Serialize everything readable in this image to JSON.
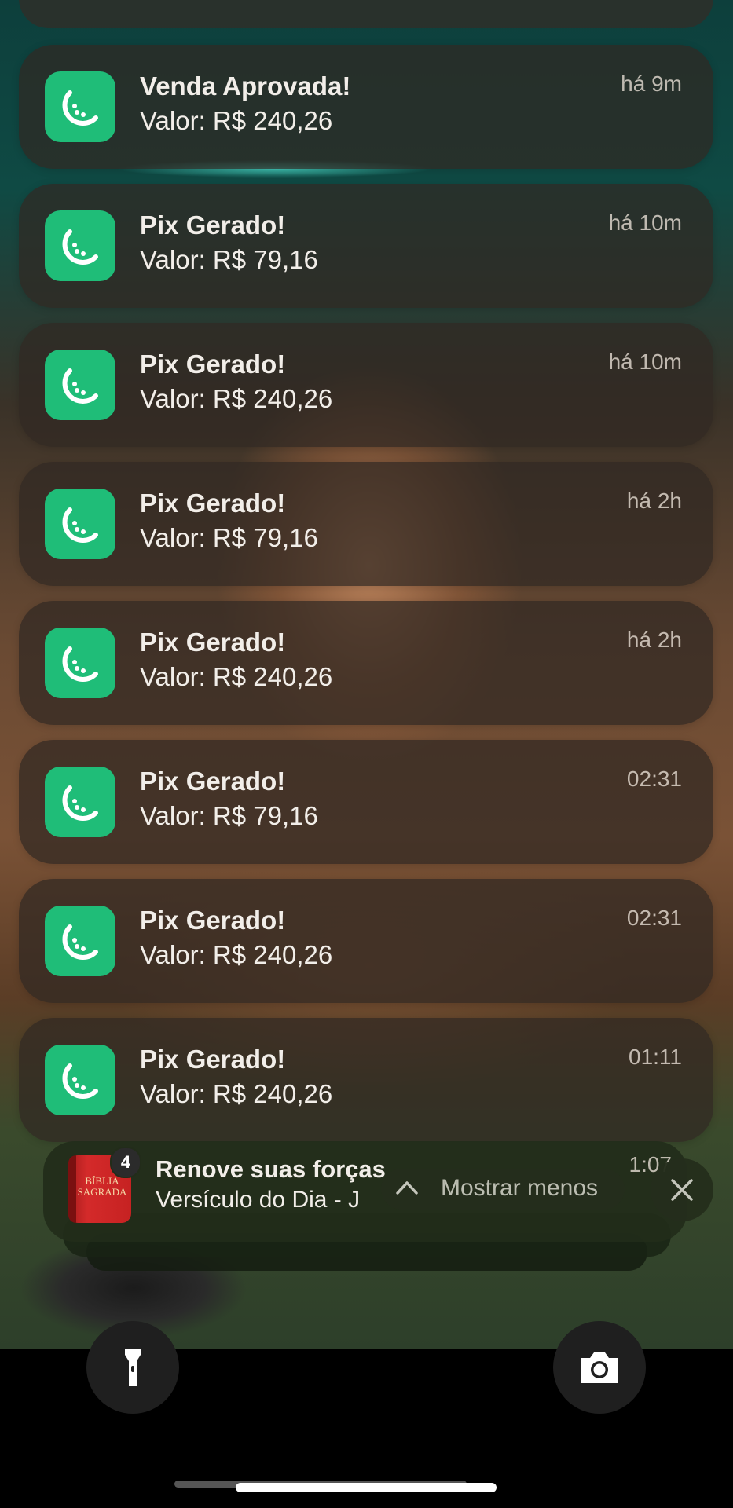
{
  "notifications": [
    {
      "title": "Venda Aprovada!",
      "body": "Valor: R$ 240,26",
      "time": "há 9m"
    },
    {
      "title": "Pix Gerado!",
      "body": "Valor: R$ 79,16",
      "time": "há 10m"
    },
    {
      "title": "Pix Gerado!",
      "body": "Valor: R$ 240,26",
      "time": "há 10m"
    },
    {
      "title": "Pix Gerado!",
      "body": "Valor: R$ 79,16",
      "time": "há 2h"
    },
    {
      "title": "Pix Gerado!",
      "body": "Valor: R$ 240,26",
      "time": "há 2h"
    },
    {
      "title": "Pix Gerado!",
      "body": "Valor: R$ 79,16",
      "time": "02:31"
    },
    {
      "title": "Pix Gerado!",
      "body": "Valor: R$ 240,26",
      "time": "02:31"
    },
    {
      "title": "Pix Gerado!",
      "body": "Valor: R$ 240,26",
      "time": "01:11"
    }
  ],
  "stacked": {
    "title": "Renove suas forças",
    "body": "Versículo do Dia - J",
    "time": "1:07",
    "badge": "4",
    "app_icon_text": "BÍBLIA SAGRADA",
    "show_less_label": "Mostrar menos"
  },
  "colors": {
    "app_icon": "#1fbd78",
    "notification_bg": "rgba(48,40,34,0.72)"
  },
  "icons": {
    "app": "melon-slice-icon",
    "flashlight": "flashlight-icon",
    "camera": "camera-icon",
    "close": "close-icon",
    "collapse": "chevron-up-icon"
  }
}
